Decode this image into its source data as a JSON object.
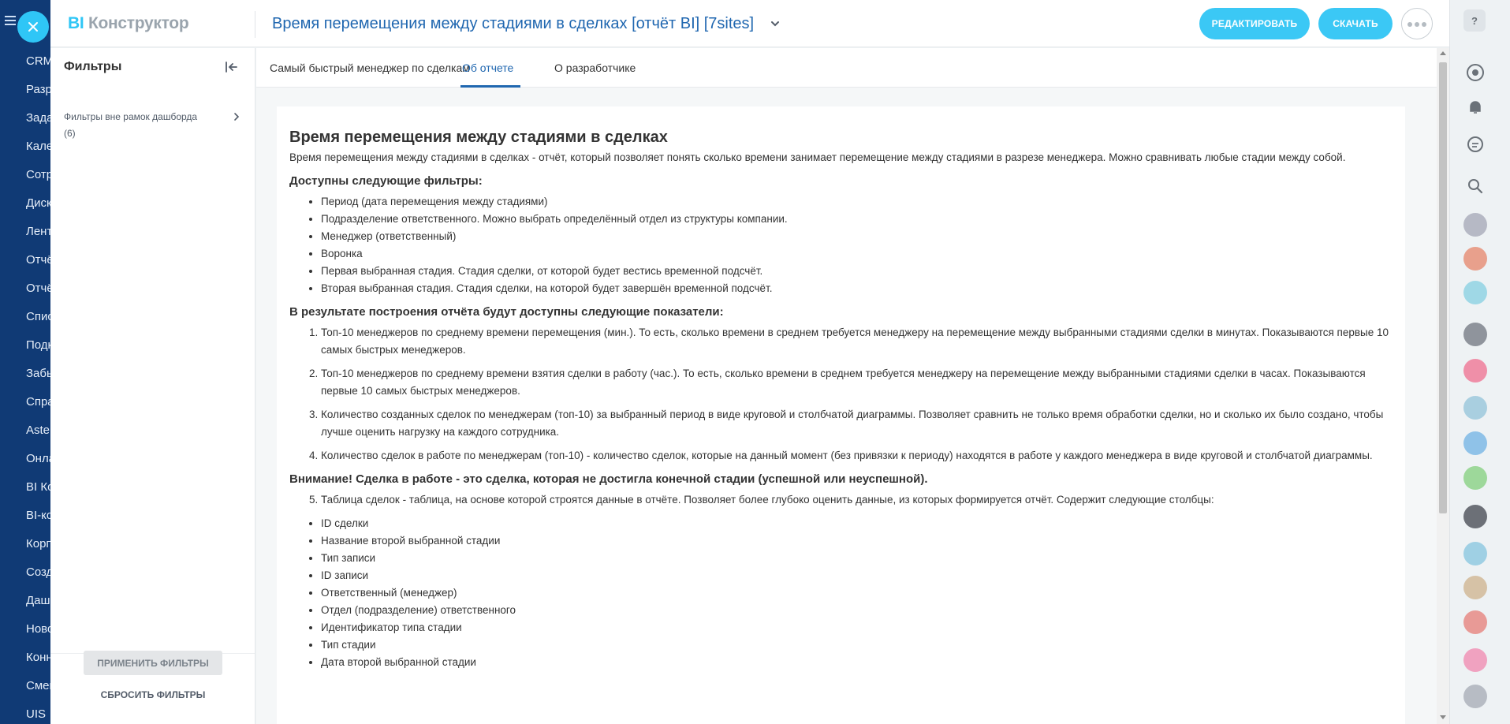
{
  "left_nav": {
    "items": [
      "CRM",
      "Разр",
      "Зада",
      "Кале",
      "Сотр",
      "Диск",
      "Лент",
      "Отчё",
      "Отчё",
      "Спис",
      "Подк",
      "Забы",
      "Спра",
      "Aster",
      "Онла",
      "BI Ко",
      "BI-ко",
      "Корп",
      "Созд",
      "Даш",
      "Ново",
      "Конн",
      "Смен",
      "UIS"
    ]
  },
  "header": {
    "brand_bi": "BI",
    "brand_name": "Конструктор",
    "title": "Время перемещения между стадиями в сделках [отчёт BI] [7sites]",
    "edit_label": "РЕДАКТИРОВАТЬ",
    "download_label": "СКАЧАТЬ"
  },
  "sidebar": {
    "title": "Фильтры",
    "filter_item": "Фильтры вне рамок дашборда (6)",
    "apply_label": "ПРИМЕНИТЬ ФИЛЬТРЫ",
    "reset_label": "СБРОСИТЬ ФИЛЬТРЫ"
  },
  "tabs": [
    "Самый быстрый менеджер по сделкам",
    "Об отчете",
    "О разработчике"
  ],
  "report": {
    "heading": "Время перемещения между стадиями в сделках",
    "intro": "Время перемещения между стадиями в сделках - отчёт, который позволяет понять сколько времени занимает перемещение между стадиями в разрезе менеджера. Можно сравнивать любые стадии между собой.",
    "filters_heading": "Доступны следующие фильтры:",
    "filters": [
      "Период (дата перемещения между стадиями)",
      "Подразделение ответственного. Можно выбрать определённый отдел из структуры компании.",
      "Менеджер (ответственный)",
      "Воронка",
      "Первая выбранная стадия. Стадия сделки, от которой будет вестись временной подсчёт.",
      "Вторая выбранная стадия. Стадия сделки, на которой будет завершён временной подсчёт."
    ],
    "metrics_heading": "В результате построения отчёта будут доступны следующие показатели:",
    "metrics": [
      "Топ-10 менеджеров по среднему времени перемещения (мин.). То есть, сколько времени в среднем требуется менеджеру на перемещение между выбранными стадиями сделки в минутах. Показываются первые 10 самых быстрых менеджеров.",
      "Топ-10 менеджеров по среднему времени взятия сделки в работу (час.). То есть, сколько времени в среднем требуется менеджеру на перемещение между выбранными стадиями сделки в часах. Показываются первые 10 самых быстрых менеджеров.",
      "Количество созданных сделок по менеджерам (топ-10) за выбранный период в виде круговой и столбчатой диаграммы. Позволяет сравнить не только время обработки сделки, но и сколько их было создано, чтобы лучше оценить нагрузку на каждого сотрудника.",
      "Количество сделок в работе по менеджерам (топ-10) - количество сделок, которые на данный момент (без привязки к периоду) находятся в работе у каждого менеджера в виде круговой и столбчатой диаграммы."
    ],
    "warning": "Внимание! Сделка в работе - это сделка, которая не достигла конечной стадии (успешной или неуспешной).",
    "table_item": "Таблица сделок - таблица, на основе которой строятся данные в отчёте. Позволяет более глубоко оценить данные, из которых формируется отчёт. Содержит следующие столбцы:",
    "columns": [
      "ID сделки",
      "Название второй выбранной стадии",
      "Тип записи",
      "ID записи",
      "Ответственный (менеджер)",
      "Отдел (подразделение) ответственного",
      "Идентификатор типа стадии",
      "Тип стадии",
      "Дата второй выбранной стадии"
    ]
  },
  "right_rail": {
    "help_label": "?"
  }
}
